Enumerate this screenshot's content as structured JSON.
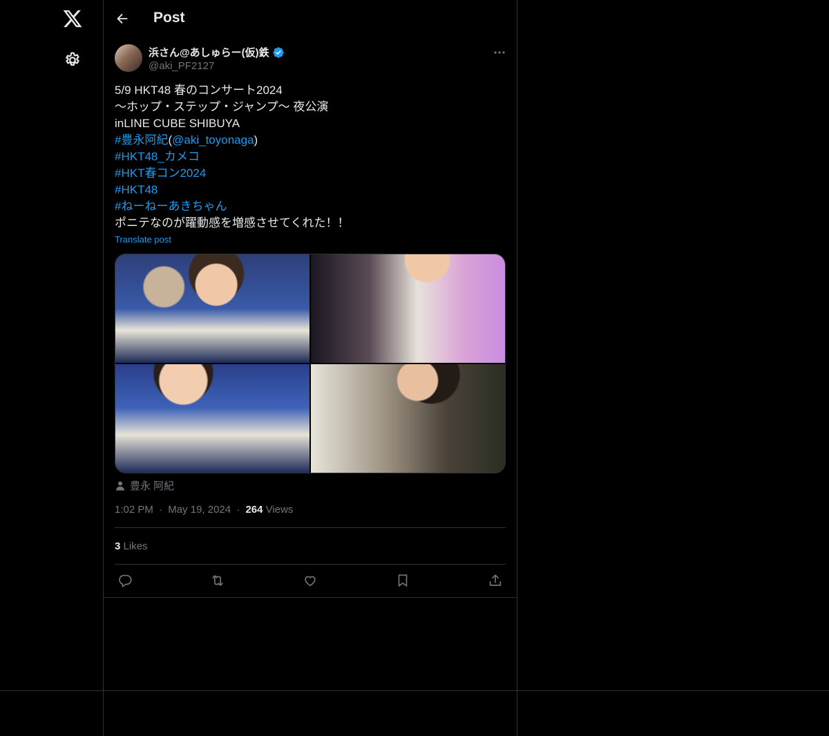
{
  "header": {
    "title": "Post"
  },
  "sidebar": {
    "icons": [
      "x-logo-icon",
      "gear-icon"
    ]
  },
  "post": {
    "author_name": "浜さん@あしゅらー(仮)鉄",
    "verified": true,
    "handle": "@aki_PF2127",
    "lines": {
      "l1": "5/9 HKT48 春のコンサート2024",
      "l2": "〜ホップ・ステップ・ジャンプ〜 夜公演",
      "l3": "inLINE CUBE SHIBUYA",
      "l4_tag": "#豊永阿紀",
      "l4_open": "(",
      "l4_mention": "@aki_toyonaga",
      "l4_close": ")",
      "l5": "#HKT48_カメコ",
      "l6": "#HKT春コン2024",
      "l7": "#HKT48",
      "l8": "#ねーねーあきちゃん",
      "l9": "ポニテなのが躍動感を増感させてくれた！！"
    },
    "translate_label": "Translate post",
    "tagged_person": "豊永 阿紀",
    "time": "1:02 PM",
    "date": "May 19, 2024",
    "views_count": "264",
    "views_label": "Views",
    "likes_count": "3",
    "likes_label": "Likes",
    "dot": "·"
  },
  "colors": {
    "accent": "#1d9bf0",
    "muted": "#71767b",
    "text": "#e7e9ea",
    "border": "#2f3336"
  }
}
